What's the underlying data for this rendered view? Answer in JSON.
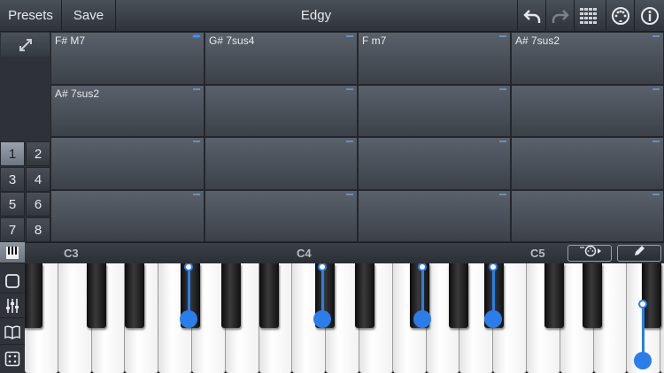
{
  "toolbar": {
    "presets_label": "Presets",
    "save_label": "Save",
    "title": "Edgy",
    "icons": [
      "undo-icon",
      "redo-icon",
      "grid-icon",
      "midi-icon",
      "info-icon"
    ]
  },
  "left_panel": {
    "expand_icon": "expand-icon",
    "set_buttons": [
      "1",
      "2",
      "3",
      "4",
      "5",
      "6",
      "7",
      "8"
    ],
    "active_set": "1"
  },
  "chord_grid": {
    "rows": [
      [
        "F# M7",
        "G# 7sus4",
        "F m7",
        "A# 7sus2"
      ],
      [
        "A# 7sus2",
        "",
        "",
        ""
      ],
      [
        "",
        "",
        "",
        ""
      ],
      [
        "",
        "",
        "",
        ""
      ]
    ],
    "active_cell": "F# M7"
  },
  "ruler": {
    "octaves": [
      "C3",
      "C4",
      "C5"
    ],
    "buttons": [
      "arpeggio-icon",
      "pencil-icon"
    ]
  },
  "side_tools": [
    "piano-keys-icon",
    "square-icon",
    "mixer-icon",
    "book-icon",
    "dice-icon"
  ],
  "colors": {
    "accent": "#2b7de9",
    "active_led": "#3f95ff"
  }
}
